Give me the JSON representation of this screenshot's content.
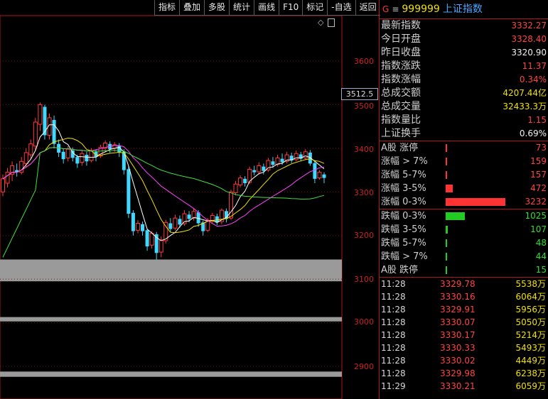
{
  "toolbar": {
    "items": [
      "指标",
      "叠加",
      "多股",
      "统计",
      "画线",
      "F10",
      "标记",
      "-自选",
      "返回"
    ]
  },
  "chart": {
    "axis_labels": [
      "3600",
      "3500",
      "3400",
      "3300",
      "3200",
      "3100",
      "3000",
      "2900"
    ],
    "current_price_label": "3512.5"
  },
  "chart_data": {
    "type": "candlestick",
    "y_ticks": [
      3600,
      3500,
      3400,
      3300,
      3200,
      3100,
      3000,
      2900
    ],
    "ylim": [
      2880,
      3700
    ],
    "candles": [
      [
        3300,
        3330,
        3290,
        3340
      ],
      [
        3320,
        3345,
        3310,
        3355
      ],
      [
        3340,
        3360,
        3325,
        3370
      ],
      [
        3350,
        3345,
        3335,
        3365
      ],
      [
        3345,
        3370,
        3340,
        3380
      ],
      [
        3365,
        3390,
        3355,
        3400
      ],
      [
        3385,
        3410,
        3375,
        3420
      ],
      [
        3405,
        3460,
        3395,
        3470
      ],
      [
        3455,
        3500,
        3440,
        3505
      ],
      [
        3495,
        3430,
        3420,
        3500
      ],
      [
        3430,
        3470,
        3420,
        3480
      ],
      [
        3465,
        3410,
        3400,
        3475
      ],
      [
        3410,
        3390,
        3380,
        3420
      ],
      [
        3392,
        3375,
        3365,
        3400
      ],
      [
        3378,
        3398,
        3370,
        3405
      ],
      [
        3395,
        3378,
        3370,
        3402
      ],
      [
        3380,
        3365,
        3355,
        3385
      ],
      [
        3368,
        3388,
        3360,
        3395
      ],
      [
        3385,
        3370,
        3360,
        3392
      ],
      [
        3372,
        3395,
        3368,
        3400
      ],
      [
        3392,
        3380,
        3370,
        3398
      ],
      [
        3382,
        3402,
        3378,
        3408
      ],
      [
        3400,
        3412,
        3392,
        3418
      ],
      [
        3410,
        3398,
        3390,
        3416
      ],
      [
        3400,
        3408,
        3392,
        3414
      ],
      [
        3406,
        3390,
        3380,
        3412
      ],
      [
        3392,
        3350,
        3340,
        3398
      ],
      [
        3352,
        3250,
        3240,
        3358
      ],
      [
        3252,
        3210,
        3200,
        3258
      ],
      [
        3212,
        3228,
        3205,
        3235
      ],
      [
        3226,
        3210,
        3200,
        3232
      ],
      [
        3212,
        3175,
        3165,
        3215
      ],
      [
        3178,
        3205,
        3170,
        3210
      ],
      [
        3203,
        3160,
        3145,
        3208
      ],
      [
        3162,
        3190,
        3150,
        3198
      ],
      [
        3188,
        3230,
        3182,
        3236
      ],
      [
        3228,
        3215,
        3208,
        3240
      ],
      [
        3217,
        3240,
        3212,
        3248
      ],
      [
        3238,
        3225,
        3218,
        3246
      ],
      [
        3227,
        3250,
        3222,
        3258
      ],
      [
        3248,
        3238,
        3230,
        3256
      ],
      [
        3240,
        3255,
        3234,
        3262
      ],
      [
        3253,
        3228,
        3220,
        3258
      ],
      [
        3230,
        3210,
        3200,
        3234
      ],
      [
        3212,
        3235,
        3208,
        3240
      ],
      [
        3233,
        3246,
        3228,
        3252
      ],
      [
        3244,
        3230,
        3224,
        3250
      ],
      [
        3232,
        3258,
        3226,
        3262
      ],
      [
        3256,
        3238,
        3230,
        3262
      ],
      [
        3240,
        3300,
        3236,
        3305
      ],
      [
        3298,
        3318,
        3292,
        3325
      ],
      [
        3316,
        3332,
        3310,
        3338
      ],
      [
        3330,
        3320,
        3312,
        3336
      ],
      [
        3322,
        3352,
        3318,
        3358
      ],
      [
        3350,
        3345,
        3338,
        3360
      ],
      [
        3346,
        3360,
        3340,
        3368
      ],
      [
        3358,
        3348,
        3340,
        3365
      ],
      [
        3350,
        3372,
        3346,
        3378
      ],
      [
        3370,
        3362,
        3355,
        3380
      ],
      [
        3363,
        3378,
        3358,
        3385
      ],
      [
        3376,
        3368,
        3362,
        3388
      ],
      [
        3370,
        3385,
        3365,
        3392
      ],
      [
        3383,
        3372,
        3366,
        3390
      ],
      [
        3374,
        3388,
        3370,
        3395
      ],
      [
        3386,
        3376,
        3370,
        3392
      ],
      [
        3378,
        3392,
        3374,
        3398
      ],
      [
        3390,
        3365,
        3360,
        3396
      ],
      [
        3366,
        3330,
        3320,
        3370
      ],
      [
        3332,
        3345,
        3328,
        3350
      ],
      [
        3340,
        3332,
        3320,
        3345
      ]
    ]
  },
  "panel": {
    "header": {
      "g": "G",
      "menu": "≡",
      "code": "999999",
      "name": "上证指数"
    },
    "stats": [
      {
        "label": "最新指数",
        "value": "3332.27",
        "color": "#ff4444"
      },
      {
        "label": "今日开盘",
        "value": "3328.40",
        "color": "#ff4444"
      },
      {
        "label": "昨日收盘",
        "value": "3320.90",
        "color": "#f0f0f0"
      },
      {
        "label": "指数涨跌",
        "value": "11.37",
        "color": "#ff4444"
      },
      {
        "label": "指数涨幅",
        "value": "0.34%",
        "color": "#ff4444"
      },
      {
        "label": "总成交额",
        "value": "4207.44亿",
        "color": "#f0e000"
      },
      {
        "label": "总成交量",
        "value": "32433.3万",
        "color": "#f0e000"
      },
      {
        "label": "指数量比",
        "value": "1.15",
        "color": "#ff4444"
      },
      {
        "label": "上证换手",
        "value": "0.69%",
        "color": "#f0f0f0"
      }
    ],
    "up": [
      {
        "label": "A股 涨停",
        "value": "73",
        "bar": 0.01
      },
      {
        "label": "涨幅 > 7%",
        "value": "159",
        "bar": 0.025
      },
      {
        "label": "涨幅 5-7%",
        "value": "157",
        "bar": 0.025
      },
      {
        "label": "涨幅 3-5%",
        "value": "472",
        "bar": 0.12
      },
      {
        "label": "涨幅 0-3%",
        "value": "3232",
        "bar": 1.0
      }
    ],
    "down": [
      {
        "label": "跌幅 0-3%",
        "value": "1025",
        "bar": 0.32
      },
      {
        "label": "跌幅 3-5%",
        "value": "107",
        "bar": 0.03
      },
      {
        "label": "跌幅 5-7%",
        "value": "48",
        "bar": 0.01
      },
      {
        "label": "跌幅 > 7%",
        "value": "44",
        "bar": 0.01
      },
      {
        "label": "A股 跌停",
        "value": "15",
        "bar": 0.005
      }
    ],
    "ticks": [
      {
        "time": "11:28",
        "price": "3329.78",
        "vol": "5538万"
      },
      {
        "time": "11:28",
        "price": "3330.16",
        "vol": "6064万"
      },
      {
        "time": "11:28",
        "price": "3329.91",
        "vol": "5956万"
      },
      {
        "time": "11:28",
        "price": "3330.07",
        "vol": "5050万"
      },
      {
        "time": "11:28",
        "price": "3330.17",
        "vol": "5214万"
      },
      {
        "time": "11:28",
        "price": "3330.33",
        "vol": "5493万"
      },
      {
        "time": "11:28",
        "price": "3330.02",
        "vol": "4449万"
      },
      {
        "time": "11:28",
        "price": "3329.98",
        "vol": "6238万"
      },
      {
        "time": "11:29",
        "price": "3330.21",
        "vol": "6059万"
      }
    ]
  }
}
